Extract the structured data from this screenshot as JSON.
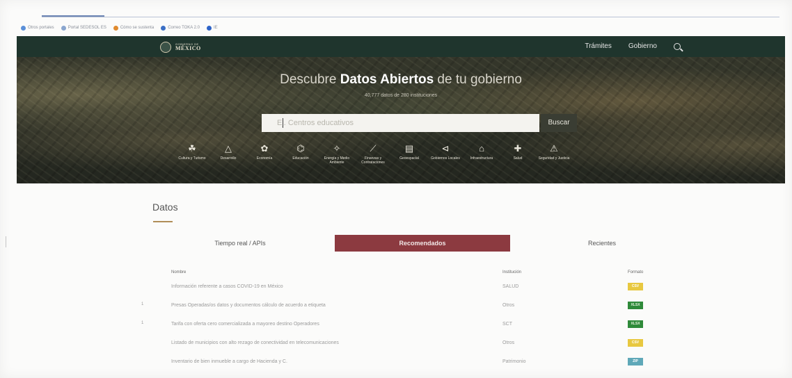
{
  "browser": {
    "bookmarks": [
      {
        "label": "Otros portales",
        "color": "#5a8fd8"
      },
      {
        "label": "Portal SEDESOL ES",
        "color": "#8aa6cf"
      },
      {
        "label": "Cómo se sustenta",
        "color": "#e08a2e"
      },
      {
        "label": "Correo TOKA 2.0",
        "color": "#3b6fc5"
      },
      {
        "label": "IE",
        "color": "#2d63c8"
      }
    ]
  },
  "header": {
    "logo_small": "GOBIERNO DE",
    "logo_big": "MÉXICO",
    "nav": [
      "Trámites",
      "Gobierno"
    ],
    "search_icon": "search-icon"
  },
  "hero": {
    "title_pre": "Descubre ",
    "title_bold": "Datos Abiertos",
    "title_post": " de tu gobierno",
    "subtitle": "40,777 datos de 280 instituciones",
    "search_placeholder": "Ej. Centros educativos",
    "search_button": "Buscar",
    "categories": [
      {
        "icon": "☘",
        "label": "Cultura y Turismo"
      },
      {
        "icon": "△",
        "label": "Desarrollo"
      },
      {
        "icon": "✿",
        "label": "Economía"
      },
      {
        "icon": "⌬",
        "label": "Educación"
      },
      {
        "icon": "✧",
        "label": "Energía y Medio Ambiente"
      },
      {
        "icon": "⟋",
        "label": "Finanzas y Contrataciones"
      },
      {
        "icon": "▤",
        "label": "Geoespacial"
      },
      {
        "icon": "⊲",
        "label": "Gobiernos Locales"
      },
      {
        "icon": "⌂",
        "label": "Infraestructura"
      },
      {
        "icon": "✚",
        "label": "Salud"
      },
      {
        "icon": "⚠",
        "label": "Seguridad y Justicia"
      }
    ]
  },
  "main": {
    "title": "Datos",
    "tabs": [
      "Tiempo real / APIs",
      "Recomendados",
      "Recientes"
    ],
    "table": {
      "headers": [
        "Nombre",
        "Institución",
        "Formato"
      ],
      "rows": [
        {
          "name": "Información referente a casos COVID-19 en México",
          "inst": "SALUD",
          "fmt": "CSV",
          "fmt_color": "#e8c840",
          "fmt_text_color": "#ffffff"
        },
        {
          "name": "Presas Operadas/os datos y documentos cálculo de acuerdo a etiqueta",
          "inst": "Otros",
          "fmt": "XLSX",
          "fmt_color": "#2f8a3a",
          "fmt_text_color": "#e8f5e0"
        },
        {
          "name": "Tarifa con oferta cero comercializada a mayoreo destino Operadores",
          "inst": "SCT",
          "fmt": "XLSX",
          "fmt_color": "#2f8a3a",
          "fmt_text_color": "#e8f5e0"
        },
        {
          "name": "Listado de municipios con alto rezago de conectividad en telecomunicaciones",
          "inst": "Otros",
          "fmt": "CSV",
          "fmt_color": "#e8c840",
          "fmt_text_color": "#ffffff"
        },
        {
          "name": "Inventario de bien inmueble a cargo de Hacienda y C.",
          "inst": "Patrimonio",
          "fmt": "ZIP",
          "fmt_color": "#5fa8b8",
          "fmt_text_color": "#ffffff"
        }
      ]
    },
    "margin_marks": [
      "1",
      "1"
    ]
  }
}
